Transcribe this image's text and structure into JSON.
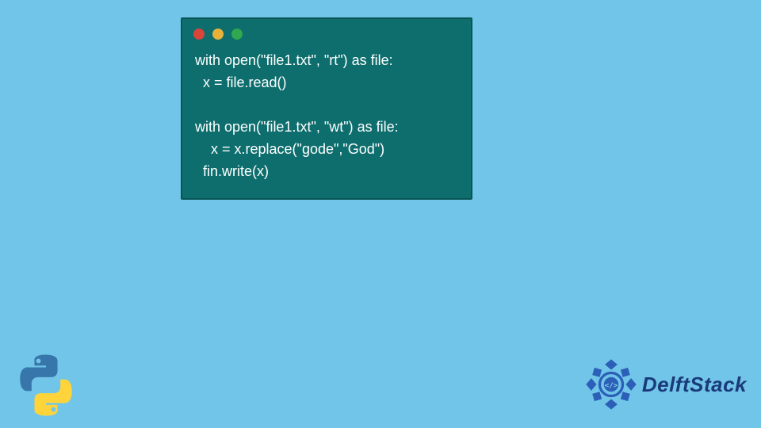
{
  "colors": {
    "background": "#71c5e8",
    "window_bg": "#0e6e6e",
    "code_text": "#ffffff",
    "dot_red": "#d9453a",
    "dot_yellow": "#e8b23a",
    "dot_green": "#2fa84f",
    "brand_text": "#1a3a7a"
  },
  "code": {
    "line1": "with open(\"file1.txt\", \"rt\") as file:",
    "line2": "  x = file.read()",
    "line3": "  ",
    "line4": "with open(\"file1.txt\", \"wt\") as file:",
    "line5": "    x = x.replace(\"gode\",\"God\")",
    "line6": "  fin.write(x)"
  },
  "brand": {
    "name": "DelftStack"
  },
  "icons": {
    "python": "python-logo",
    "brand": "delftstack-logo"
  }
}
